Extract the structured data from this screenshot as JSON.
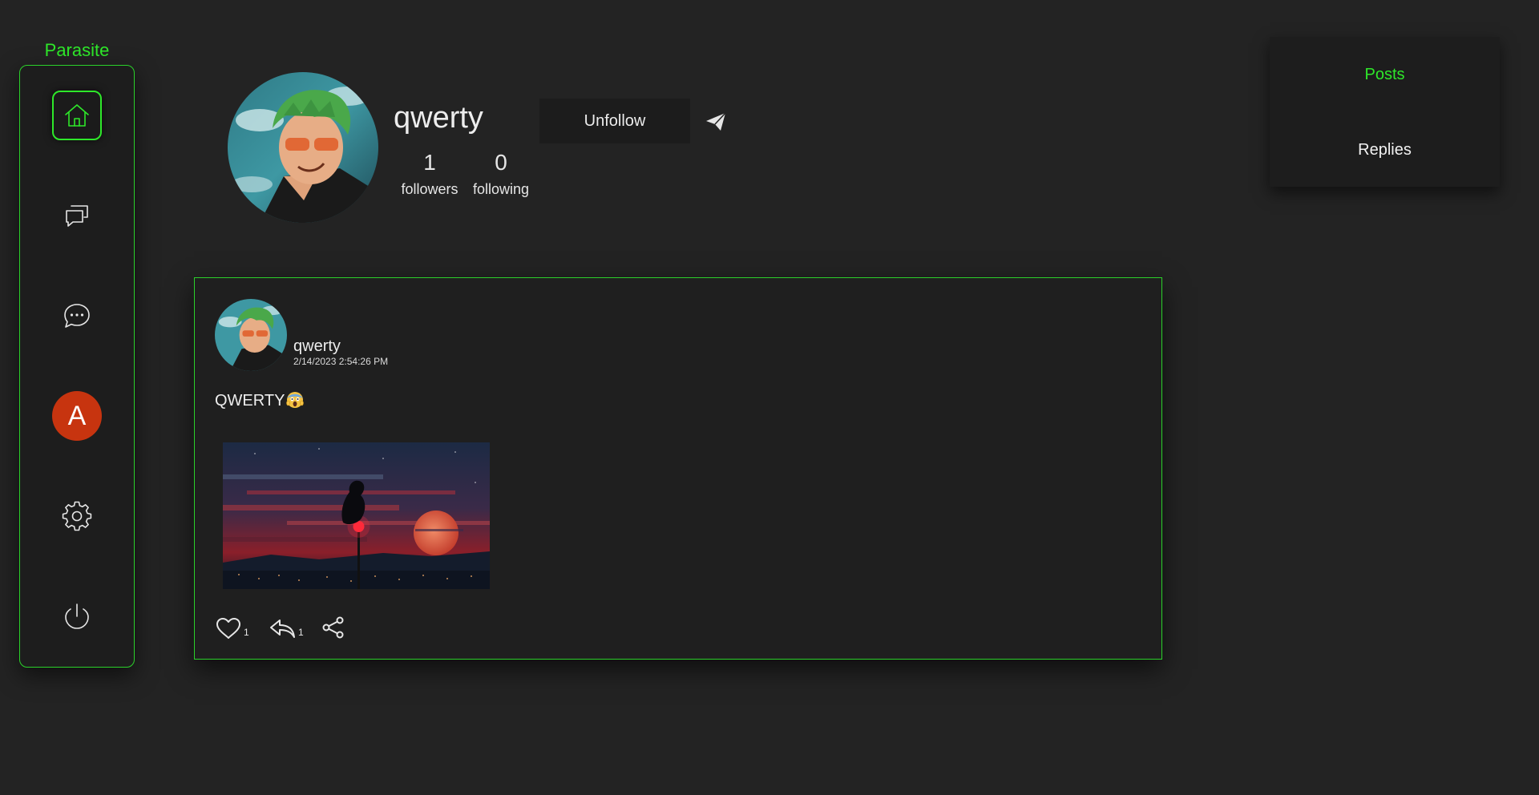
{
  "brand": {
    "name": "Parasite",
    "color": "#2ee82a"
  },
  "sidebar": {
    "items": [
      {
        "name": "home",
        "icon": "home-icon",
        "active": true
      },
      {
        "name": "discussions",
        "icon": "chat-bubbles-icon",
        "active": false
      },
      {
        "name": "messages",
        "icon": "message-dots-icon",
        "active": false
      },
      {
        "name": "profile",
        "avatar_letter": "A",
        "avatar_color": "#c7340f"
      },
      {
        "name": "settings",
        "icon": "gear-icon",
        "active": false
      },
      {
        "name": "logout",
        "icon": "power-icon",
        "active": false
      }
    ]
  },
  "profile": {
    "username": "qwerty",
    "followers_count": "1",
    "followers_label": "followers",
    "following_count": "0",
    "following_label": "following",
    "unfollow_label": "Unfollow",
    "message_icon": "send-icon"
  },
  "tabs": {
    "items": [
      {
        "label": "Posts",
        "active": true
      },
      {
        "label": "Replies",
        "active": false
      }
    ]
  },
  "post": {
    "author": "qwerty",
    "timestamp": "2/14/2023 2:54:26 PM",
    "text": "QWERTY",
    "emoji_icon": "screaming-face-emoji",
    "likes": "1",
    "replies": "1",
    "like_icon": "heart-icon",
    "reply_icon": "reply-icon",
    "share_icon": "share-icon"
  },
  "colors": {
    "background": "#232323",
    "panel": "#1d1d1d",
    "accent": "#2ee82a"
  }
}
